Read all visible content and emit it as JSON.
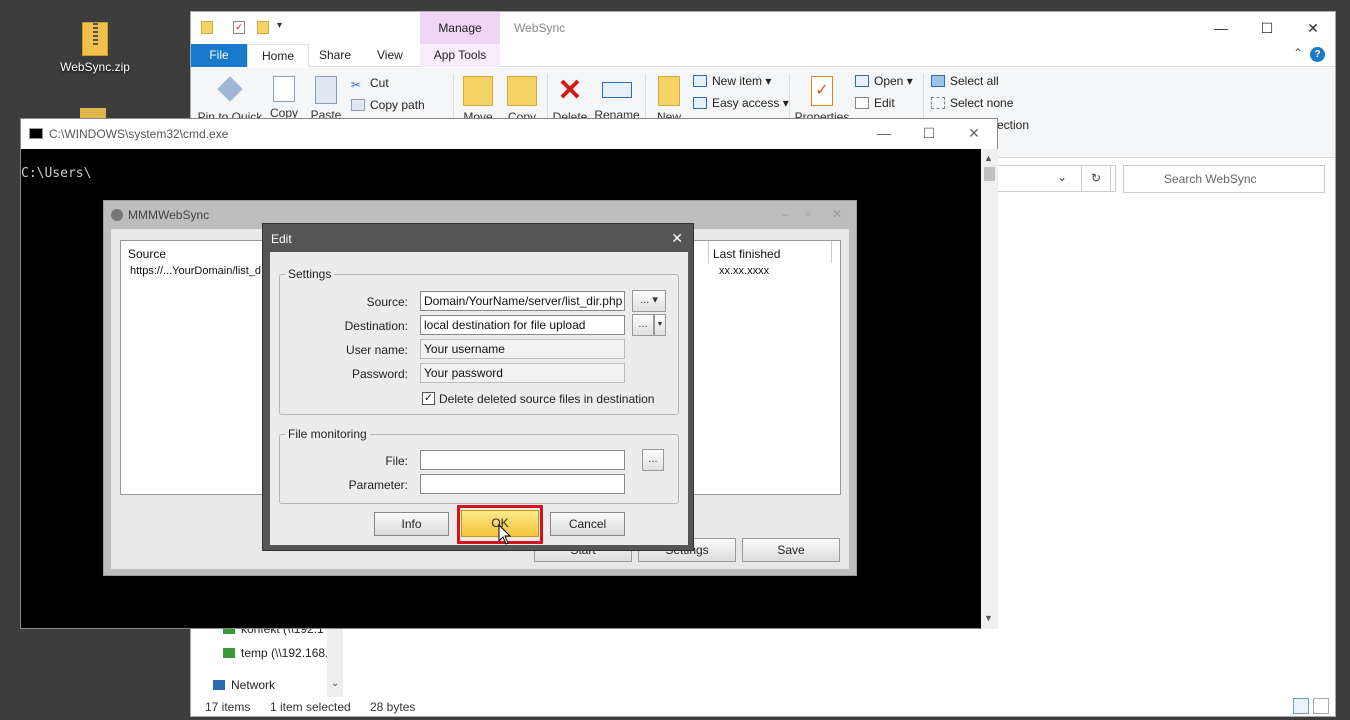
{
  "desktop": {
    "icon_label": "WebSync.zip"
  },
  "explorer": {
    "manage_tab": "Manage",
    "title": "WebSync",
    "tabs": [
      "File",
      "Home",
      "Share",
      "View",
      "App Tools"
    ],
    "ribbon": {
      "pin": "Pin to Quick",
      "copy": "Copy",
      "paste": "Paste",
      "cut": "Cut",
      "copy_path": "Copy path",
      "move": "Move",
      "copy_to": "Copy",
      "delete": "Delete",
      "rename": "Rename",
      "new": "New",
      "new_item": "New item ▾",
      "easy_access": "Easy access ▾",
      "properties": "Properties",
      "open": "Open ▾",
      "edit": "Edit",
      "select_all": "Select all",
      "select_none": "Select none",
      "invert_selection": "ection"
    },
    "search_placeholder": "Search WebSync",
    "nav": [
      "konfekt (\\\\192.1",
      "temp (\\\\192.168.",
      "Network"
    ],
    "status": {
      "items": "17 items",
      "selected": "1 item selected",
      "size": "28 bytes"
    }
  },
  "cmd": {
    "title": "C:\\WINDOWS\\system32\\cmd.exe",
    "prompt": "C:\\Users\\"
  },
  "mmm": {
    "title": "MMMWebSync",
    "col_source": "Source",
    "col_last": "Last finished",
    "row_source": "https://...YourDomain/list_d",
    "row_last": "xx.xx.xxxx",
    "btn_start": "Start",
    "btn_settings": "Settings",
    "btn_save": "Save"
  },
  "edit": {
    "title": "Edit",
    "settings_group": "Settings",
    "source_label": "Source:",
    "source_value": "Domain/YourName/server/list_dir.php",
    "dest_label": "Destination:",
    "dest_value": "local destination for file upload",
    "user_label": "User name:",
    "user_value": "Your username",
    "pass_label": "Password:",
    "pass_value": "Your password",
    "delete_check": "Delete deleted source files in destination",
    "monitor_group": "File monitoring",
    "file_label": "File:",
    "param_label": "Parameter:",
    "dots": "...",
    "btn_info": "Info",
    "btn_ok": "OK",
    "btn_cancel": "Cancel"
  }
}
